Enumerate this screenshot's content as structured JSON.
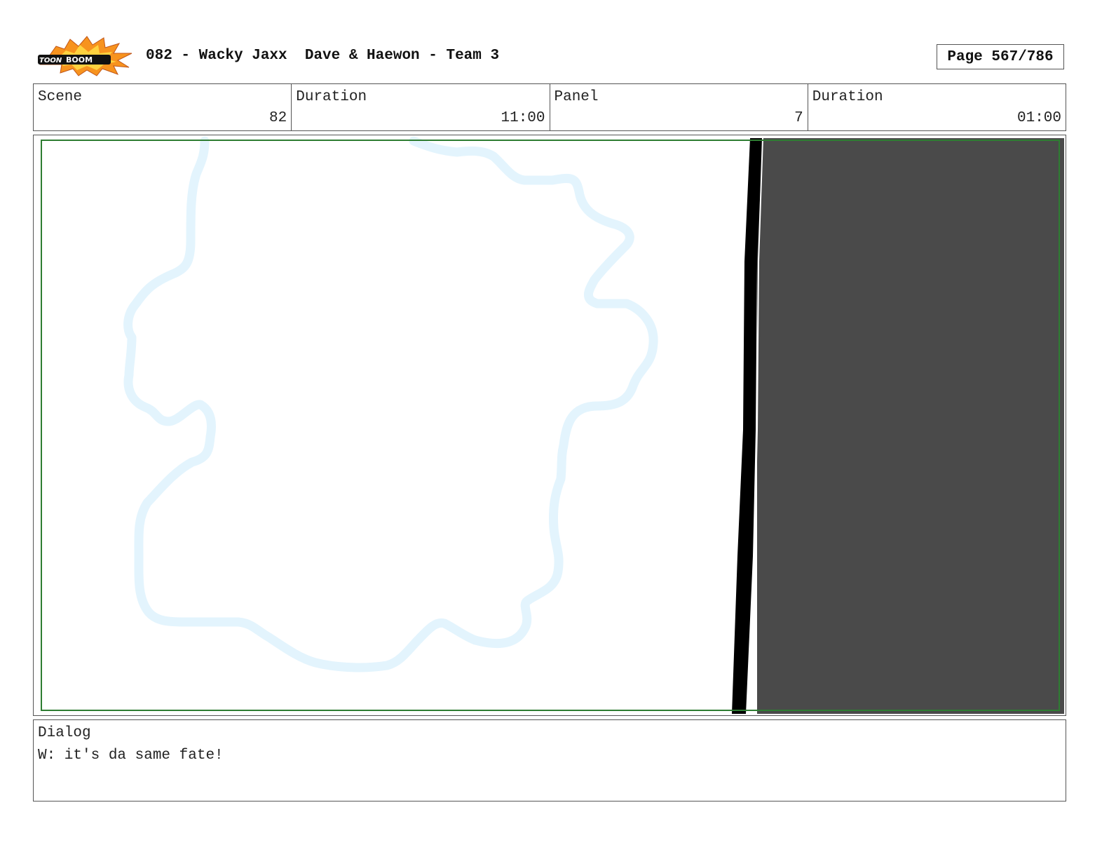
{
  "header": {
    "logo_text": "TOONBOOM",
    "title": "082 - Wacky Jaxx  Dave & Haewon - Team 3",
    "page": "Page 567/786"
  },
  "info": {
    "scene_label": "Scene",
    "scene_value": "82",
    "scene_duration_label": "Duration",
    "scene_duration_value": "11:00",
    "panel_label": "Panel",
    "panel_value": "7",
    "panel_duration_label": "Duration",
    "panel_duration_value": "01:00"
  },
  "dialog": {
    "label": "Dialog",
    "text": "W: it's da same fate!"
  },
  "colors": {
    "frame_guide": "#2e7d32",
    "cloud_outline": "#e3f4fd",
    "dark_area": "#4a4a4a",
    "logo_orange": "#f7931e",
    "logo_yellow": "#ffd23f"
  }
}
